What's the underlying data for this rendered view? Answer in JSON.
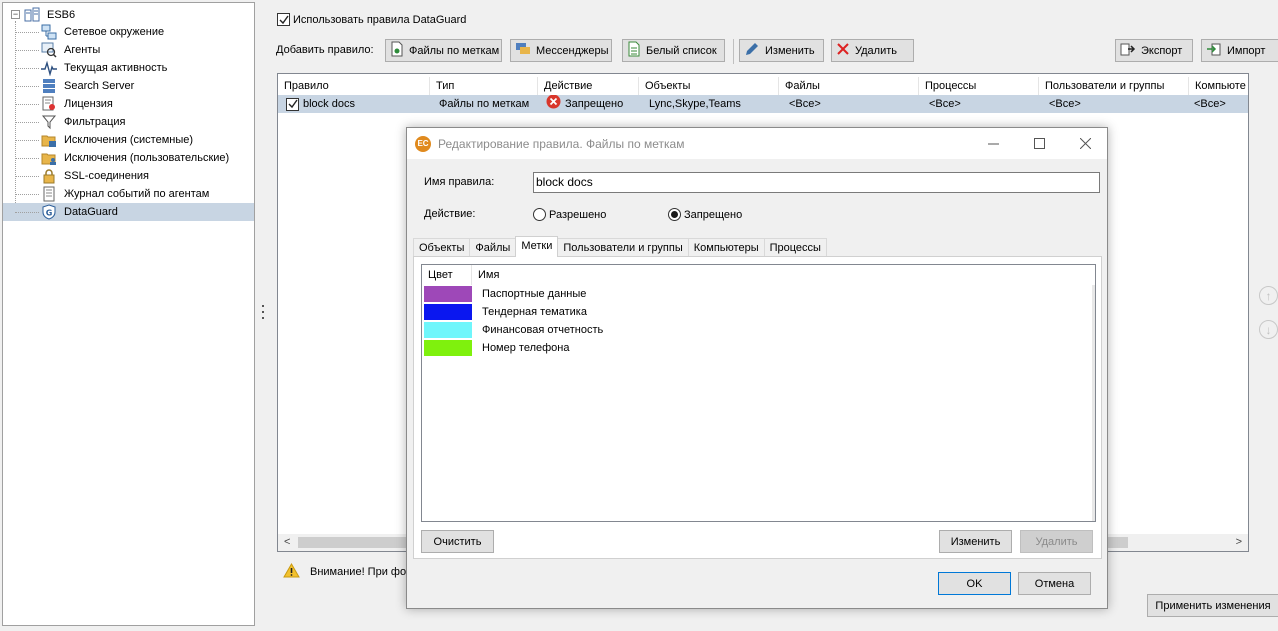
{
  "tree": {
    "root": "ESB6",
    "items": [
      {
        "label": "Сетевое окружение",
        "icon": "network-icon"
      },
      {
        "label": "Агенты",
        "icon": "agents-icon"
      },
      {
        "label": "Текущая активность",
        "icon": "activity-icon"
      },
      {
        "label": "Search Server",
        "icon": "server-icon"
      },
      {
        "label": "Лицензия",
        "icon": "license-icon"
      },
      {
        "label": "Фильтрация",
        "icon": "filter-icon"
      },
      {
        "label": "Исключения (системные)",
        "icon": "folder-system-icon"
      },
      {
        "label": "Исключения (пользовательские)",
        "icon": "folder-user-icon"
      },
      {
        "label": "SSL-соединения",
        "icon": "lock-icon"
      },
      {
        "label": "Журнал событий по агентам",
        "icon": "journal-icon"
      },
      {
        "label": "DataGuard",
        "icon": "dataguard-icon"
      }
    ]
  },
  "use_rules_label": "Использовать правила DataGuard",
  "toolbar": {
    "add_rule_label": "Добавить правило:",
    "files_by_tags": "Файлы по меткам",
    "messengers": "Мессенджеры",
    "whitelist": "Белый список",
    "edit": "Изменить",
    "delete": "Удалить",
    "export": "Экспорт",
    "import": "Импорт"
  },
  "grid": {
    "columns": [
      "Правило",
      "Тип",
      "Действие",
      "Объекты",
      "Файлы",
      "Процессы",
      "Пользователи и группы",
      "Компьюте"
    ],
    "row": {
      "rule": "block docs",
      "type": "Файлы по меткам",
      "action": "Запрещено",
      "objects": "Lync,Skype,Teams",
      "files": "<Все>",
      "processes": "<Все>",
      "users": "<Все>",
      "computers": "<Все>"
    }
  },
  "warning_text": "Внимание! При фор",
  "apply_label": "Применить изменения",
  "dialog": {
    "logo": "EC",
    "title": "Редактирование правила. Файлы по меткам",
    "rule_name_label": "Имя правила:",
    "rule_name_value": "block docs",
    "action_label": "Действие:",
    "allowed": "Разрешено",
    "denied": "Запрещено",
    "tabs": [
      "Объекты",
      "Файлы",
      "Метки",
      "Пользователи и группы",
      "Компьютеры",
      "Процессы"
    ],
    "active_tab": "Метки",
    "tag_columns": {
      "color": "Цвет",
      "name": "Имя"
    },
    "tags": [
      {
        "name": "Паспортные данные",
        "color": "#9e48b8"
      },
      {
        "name": "Тендерная тематика",
        "color": "#0a17f0"
      },
      {
        "name": "Финансовая отчетность",
        "color": "#6ff6fb"
      },
      {
        "name": "Номер телефона",
        "color": "#7ff10d"
      }
    ],
    "clear": "Очистить",
    "edit": "Изменить",
    "delete": "Удалить",
    "ok": "OK",
    "cancel": "Отмена"
  }
}
